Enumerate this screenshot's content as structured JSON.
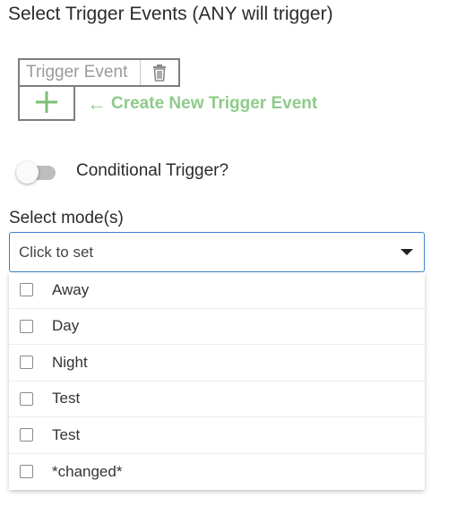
{
  "heading": "Select Trigger Events (ANY will trigger)",
  "trigger_event": {
    "label": "Trigger Event",
    "delete_icon": "trash-icon"
  },
  "add_trigger": {
    "icon": "plus-icon",
    "hint": "Create New Trigger Event",
    "hint_icon": "arrow-left-icon"
  },
  "conditional": {
    "label": "Conditional Trigger?",
    "enabled": false
  },
  "modes": {
    "label": "Select mode(s)",
    "placeholder": "Click to set",
    "options": [
      "Away",
      "Day",
      "Night",
      "Test",
      "Test",
      "*changed*"
    ]
  },
  "colors": {
    "accent_green": "#8ecb8a",
    "focus_blue": "#3f7fd0"
  }
}
